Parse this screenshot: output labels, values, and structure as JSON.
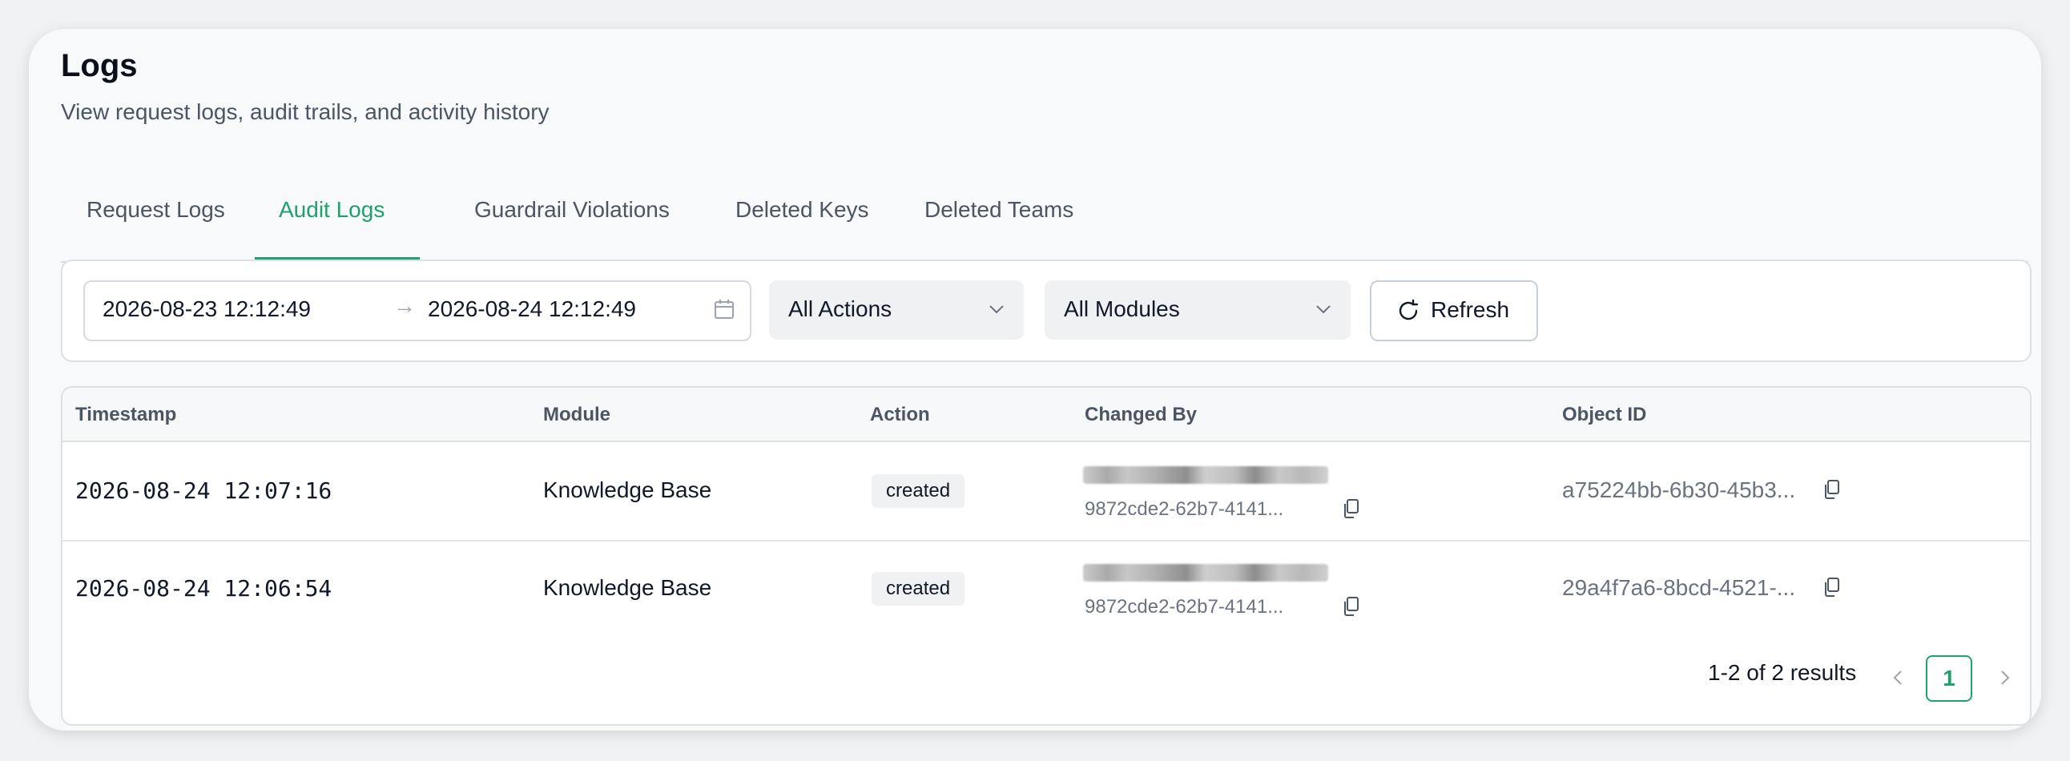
{
  "page": {
    "title": "Logs",
    "subtitle": "View request logs, audit trails, and activity history"
  },
  "tabs": [
    {
      "label": "Request Logs",
      "active": false
    },
    {
      "label": "Audit Logs",
      "active": true
    },
    {
      "label": "Guardrail Violations",
      "active": false
    },
    {
      "label": "Deleted Keys",
      "active": false
    },
    {
      "label": "Deleted Teams",
      "active": false
    }
  ],
  "filters": {
    "date_start": "2026-08-23 12:12:49",
    "date_end": "2026-08-24 12:12:49",
    "date_separator": "→",
    "action_select": "All Actions",
    "module_select": "All Modules",
    "refresh_label": "Refresh"
  },
  "table": {
    "columns": [
      "Timestamp",
      "Module",
      "Action",
      "Changed By",
      "Object ID"
    ],
    "rows": [
      {
        "timestamp": "2026-08-24 12:07:16",
        "module": "Knowledge Base",
        "action": "created",
        "changed_by_id": "9872cde2-62b7-4141...",
        "object_id": "a75224bb-6b30-45b3..."
      },
      {
        "timestamp": "2026-08-24 12:06:54",
        "module": "Knowledge Base",
        "action": "created",
        "changed_by_id": "9872cde2-62b7-4141...",
        "object_id": "29a4f7a6-8bcd-4521-..."
      }
    ]
  },
  "pagination": {
    "summary": "1-2 of 2 results",
    "current_page": "1"
  },
  "colors": {
    "accent": "#22a06e",
    "card_bg": "#f8f9fb",
    "border": "#dde1e6"
  },
  "icons": [
    "calendar-icon",
    "chevron-down-icon",
    "refresh-icon",
    "copy-icon",
    "chevron-left-icon",
    "chevron-right-icon"
  ]
}
